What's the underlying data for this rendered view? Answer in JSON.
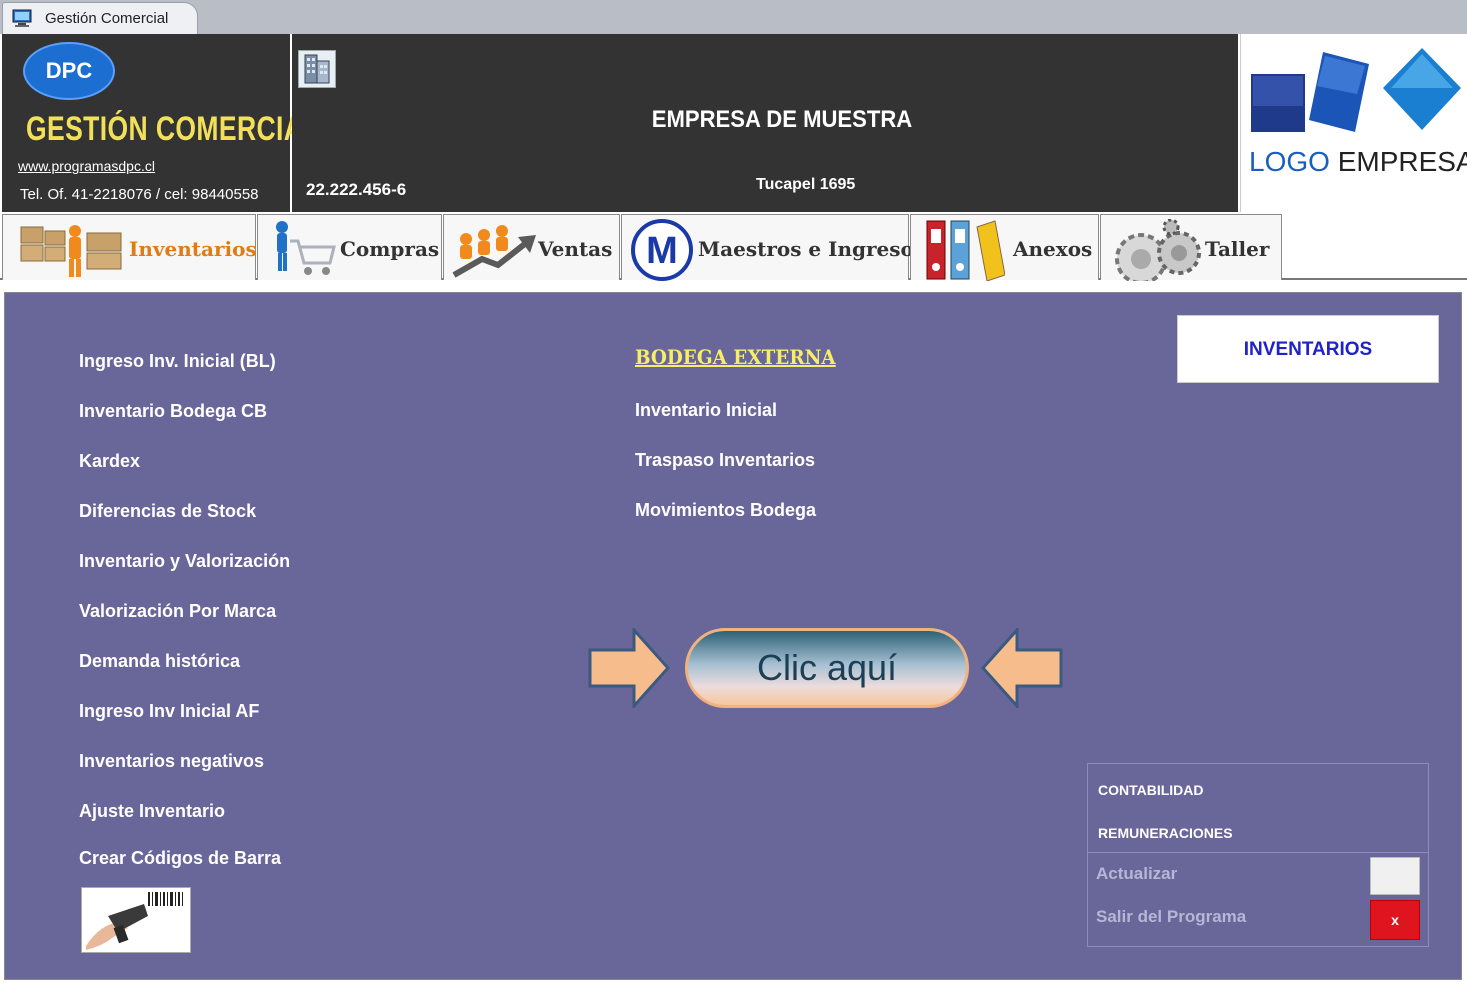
{
  "window": {
    "tab_title": "Gestión Comercial"
  },
  "header": {
    "brand": {
      "badge": "DPC",
      "title": "GESTIÓN COMERCIAL",
      "url": "www.programasdpc.cl",
      "phone": "Tel. Of. 41-2218076 / cel: 98440558"
    },
    "company": {
      "name": "EMPRESA DE MUESTRA",
      "rut": "22.222.456-6",
      "address": "Tucapel 1695"
    },
    "logo": {
      "word1": "LOGO",
      "word2": "EMPRESA"
    }
  },
  "tabs": [
    {
      "label": "Inventarios",
      "active": true
    },
    {
      "label": "Compras"
    },
    {
      "label": "Ventas"
    },
    {
      "label": "Maestros e Ingresos"
    },
    {
      "label": "Anexos"
    },
    {
      "label": "Taller"
    }
  ],
  "section_badge": "INVENTARIOS",
  "menu_left": [
    "Ingreso Inv. Inicial (BL)",
    "Inventario Bodega CB",
    "Kardex",
    "Diferencias de Stock",
    "Inventario y Valorización",
    "Valorización Por Marca",
    "Demanda histórica",
    "Ingreso Inv Inicial AF",
    "Inventarios negativos",
    "Ajuste Inventario",
    "Crear Códigos de Barra"
  ],
  "bodega": {
    "title": "BODEGA EXTERNA",
    "items": [
      "Inventario Inicial",
      "Traspaso Inventarios",
      "Movimientos Bodega"
    ]
  },
  "click_button": "Clic aquí",
  "side_panel": {
    "links": [
      "CONTABILIDAD",
      "REMUNERACIONES"
    ],
    "refresh_label": "Actualizar",
    "exit_label": "Salir del Programa",
    "exit_button": "x"
  },
  "colors": {
    "panel_bg": "#69669a",
    "header_bg": "#333333",
    "active_tab_text": "#e07c16",
    "brand_yellow": "#f2e05a",
    "badge_blue": "#1e22c8",
    "exit_red": "#e0141e"
  },
  "icons": {
    "window": "computer-icon",
    "company": "building-icon",
    "inventarios": "worker-boxes-icon",
    "compras": "shopping-cart-icon",
    "ventas": "sales-growth-icon",
    "maestros": "letter-m-circle-icon",
    "anexos": "binders-icon",
    "taller": "gears-icon",
    "barcode": "barcode-scanner-icon",
    "arrows": "arrow-right-icon"
  }
}
